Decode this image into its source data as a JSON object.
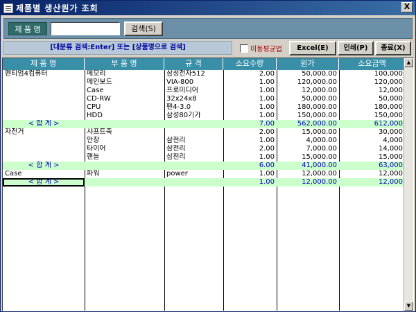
{
  "window": {
    "title": "제품별 생산원가 조회",
    "close_label": "X"
  },
  "search": {
    "label": "제 품 명",
    "input_value": "",
    "button_label": "검색(S)"
  },
  "toolbar": {
    "hint": "[대분류 검색:Enter] 또는 [상품명으로 검색]",
    "checkbox_label": "이동평균법",
    "excel_label": "Excel(E)",
    "print_label": "인쇄(P)",
    "exit_label": "종료(X)"
  },
  "grid": {
    "columns": [
      "제 품 명",
      "부 품 명",
      "규 격",
      "소요수량",
      "원가",
      "소요금액"
    ],
    "rows": [
      {
        "type": "item",
        "cells": [
          "펜티엄4컴퓨터",
          "메모리",
          "삼성전자512",
          "2.00",
          "50,000.00",
          "100,000"
        ]
      },
      {
        "type": "item",
        "cells": [
          "",
          "메인보드",
          "VIA-800",
          "1.00",
          "120,000.00",
          "120,000"
        ]
      },
      {
        "type": "item",
        "cells": [
          "",
          "Case",
          "프로미디어",
          "1.00",
          "12,000.00",
          "12,000"
        ]
      },
      {
        "type": "item",
        "cells": [
          "",
          "CD-RW",
          "32x24x8",
          "1.00",
          "50,000.00",
          "50,000"
        ]
      },
      {
        "type": "item",
        "cells": [
          "",
          "CPU",
          "펜4-3.0",
          "1.00",
          "180,000.00",
          "180,000"
        ]
      },
      {
        "type": "item",
        "cells": [
          "",
          "HDD",
          "삼성80기가",
          "1.00",
          "150,000.00",
          "150,000"
        ]
      },
      {
        "type": "sum",
        "cells": [
          "< 합     계 >",
          "",
          "",
          "7.00",
          "562,000.00",
          "612,000"
        ]
      },
      {
        "type": "item",
        "cells": [
          "자전거",
          "샤프트축",
          "",
          "2.00",
          "15,000.00",
          "30,000"
        ]
      },
      {
        "type": "item",
        "cells": [
          "",
          "안장",
          "삼천리",
          "1.00",
          "4,000.00",
          "4,000"
        ]
      },
      {
        "type": "item",
        "cells": [
          "",
          "타이어",
          "삼천리",
          "2.00",
          "7,000.00",
          "14,000"
        ]
      },
      {
        "type": "item",
        "cells": [
          "",
          "핸들",
          "삼천리",
          "1.00",
          "15,000.00",
          "15,000"
        ]
      },
      {
        "type": "sum",
        "cells": [
          "< 합     계 >",
          "",
          "",
          "6.00",
          "41,000.00",
          "63,000"
        ]
      },
      {
        "type": "item",
        "cells": [
          "Case",
          "파워",
          "power",
          "1.00",
          "12,000.00",
          "12,000"
        ]
      },
      {
        "type": "sum",
        "selected": true,
        "cells": [
          "< 합     계 >",
          "",
          "",
          "1.00",
          "12,000.00",
          "12,000"
        ]
      }
    ]
  },
  "icons": {
    "app": "document-icon",
    "close": "close-icon",
    "scroll_up": "scroll-up-icon",
    "scroll_down": "scroll-down-icon"
  },
  "colors": {
    "header_bg": "#3a8fa8",
    "sum_row_bg": "#ccffcc",
    "sum_text": "#0000c0",
    "search_panel": "#6b8fa6"
  }
}
